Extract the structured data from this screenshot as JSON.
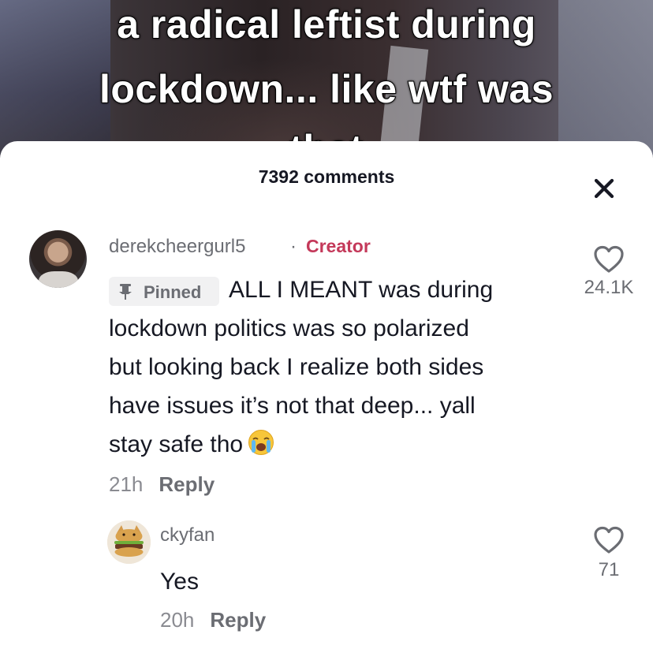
{
  "video": {
    "caption_lines": [
      "a radical leftist during",
      "lockdown... like wtf was",
      "that"
    ]
  },
  "comments_panel": {
    "count_label": "7392 comments",
    "close_icon": "close-icon"
  },
  "comments": [
    {
      "username": "derekcheergurl5",
      "separator": "·",
      "badge": "Creator",
      "pinned_label": "Pinned",
      "text_first": "ALL I MEANT was during",
      "text_lines": [
        "lockdown politics was so polarized",
        "but looking back I realize both sides",
        "have issues it’s not that deep... yall",
        "stay safe tho"
      ],
      "emoji": "loudly-crying-face",
      "time": "21h",
      "reply_label": "Reply",
      "likes": "24.1K",
      "like_icon": "heart-outline-icon"
    },
    {
      "username": "ckyfan",
      "text": "Yes",
      "time": "20h",
      "reply_label": "Reply",
      "likes": "71",
      "like_icon": "heart-outline-icon",
      "avatar": "hamburger-cat-avatar"
    }
  ],
  "colors": {
    "creator_badge": "#c4395a",
    "text_primary": "#161823",
    "text_secondary": "#8a8b91"
  }
}
